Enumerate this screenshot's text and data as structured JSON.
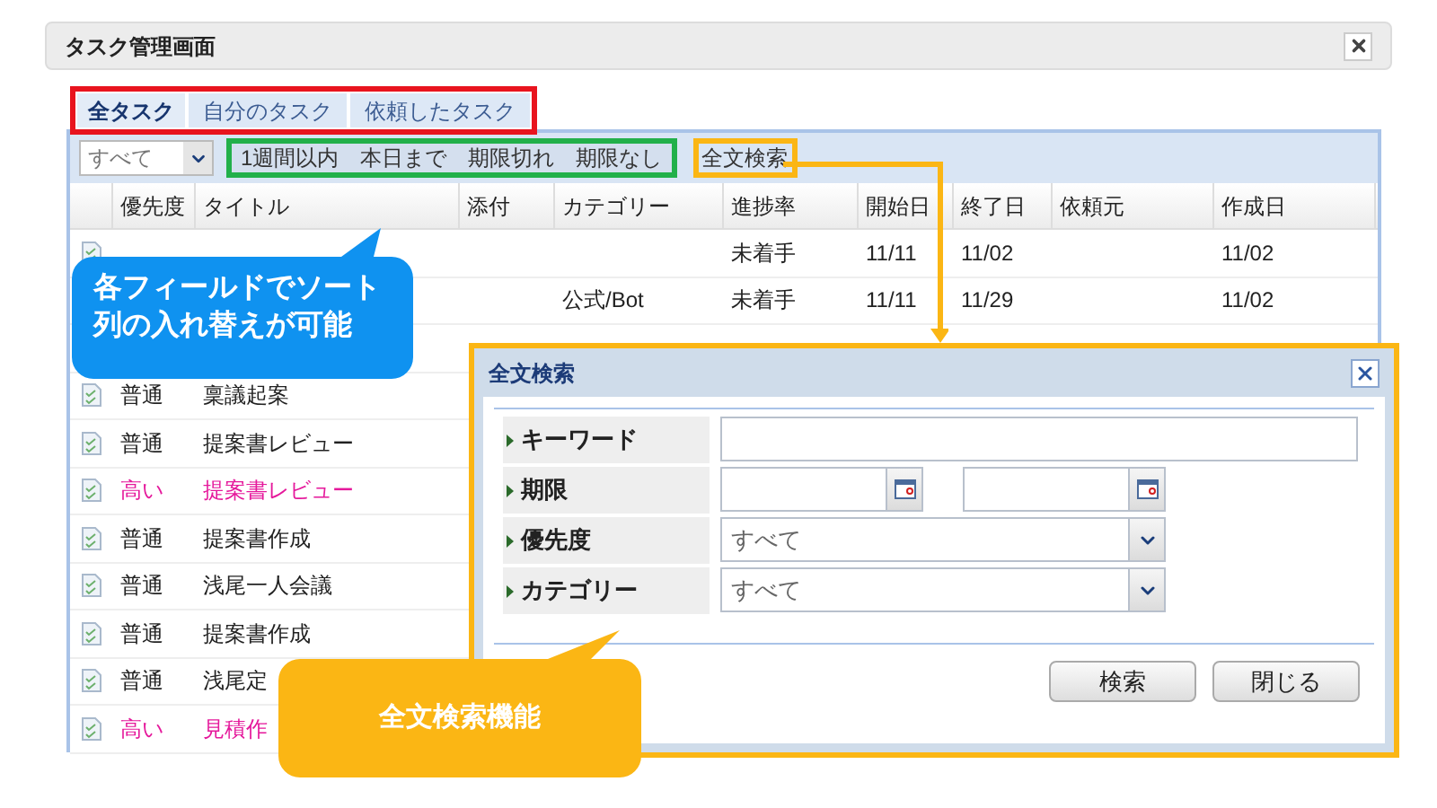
{
  "window": {
    "title": "タスク管理画面"
  },
  "tabs": [
    {
      "label": "全タスク",
      "selected": true
    },
    {
      "label": "自分のタスク",
      "selected": false
    },
    {
      "label": "依頼したタスク",
      "selected": false
    }
  ],
  "toolbar": {
    "filter_select": "すべて",
    "quick_filters": [
      "1週間以内",
      "本日まで",
      "期限切れ",
      "期限なし"
    ],
    "search_button": "全文検索"
  },
  "table": {
    "columns": [
      "優先度",
      "タイトル",
      "添付",
      "カテゴリー",
      "進捗率",
      "開始日",
      "終了日",
      "依頼元",
      "作成日"
    ],
    "rows": [
      {
        "high": false,
        "progress": "未着手",
        "start": "11/11",
        "end": "11/02",
        "created": "11/02"
      },
      {
        "high": false,
        "category": "公式/Bot",
        "progress": "未着手",
        "start": "11/11",
        "end": "11/29",
        "created": "11/02"
      },
      {
        "high": false,
        "priority": "普通",
        "title": "稟議起案"
      },
      {
        "high": false,
        "priority": "普通",
        "title": "提案書レビュー"
      },
      {
        "high": true,
        "priority": "高い",
        "title": "提案書レビュー"
      },
      {
        "high": false,
        "priority": "普通",
        "title": "提案書作成"
      },
      {
        "high": false,
        "priority": "普通",
        "title": "浅尾一人会議"
      },
      {
        "high": false,
        "priority": "普通",
        "title": "提案書作成"
      },
      {
        "high": false,
        "priority": "普通",
        "title": "浅尾定"
      },
      {
        "high": true,
        "priority": "高い",
        "title": "見積作"
      }
    ]
  },
  "dialog": {
    "title": "全文検索",
    "fields": [
      {
        "kind": "text",
        "label": "キーワード"
      },
      {
        "kind": "date_range",
        "label": "期限"
      },
      {
        "kind": "select",
        "label": "優先度",
        "value": "すべて"
      },
      {
        "kind": "select",
        "label": "カテゴリー",
        "value": "すべて"
      }
    ],
    "buttons": [
      "検索",
      "閉じる"
    ]
  },
  "callouts": [
    {
      "lines": [
        "各フィールドでソート",
        "列の入れ替えが可能"
      ]
    },
    {
      "lines": [
        "全文検索機能"
      ]
    }
  ]
}
